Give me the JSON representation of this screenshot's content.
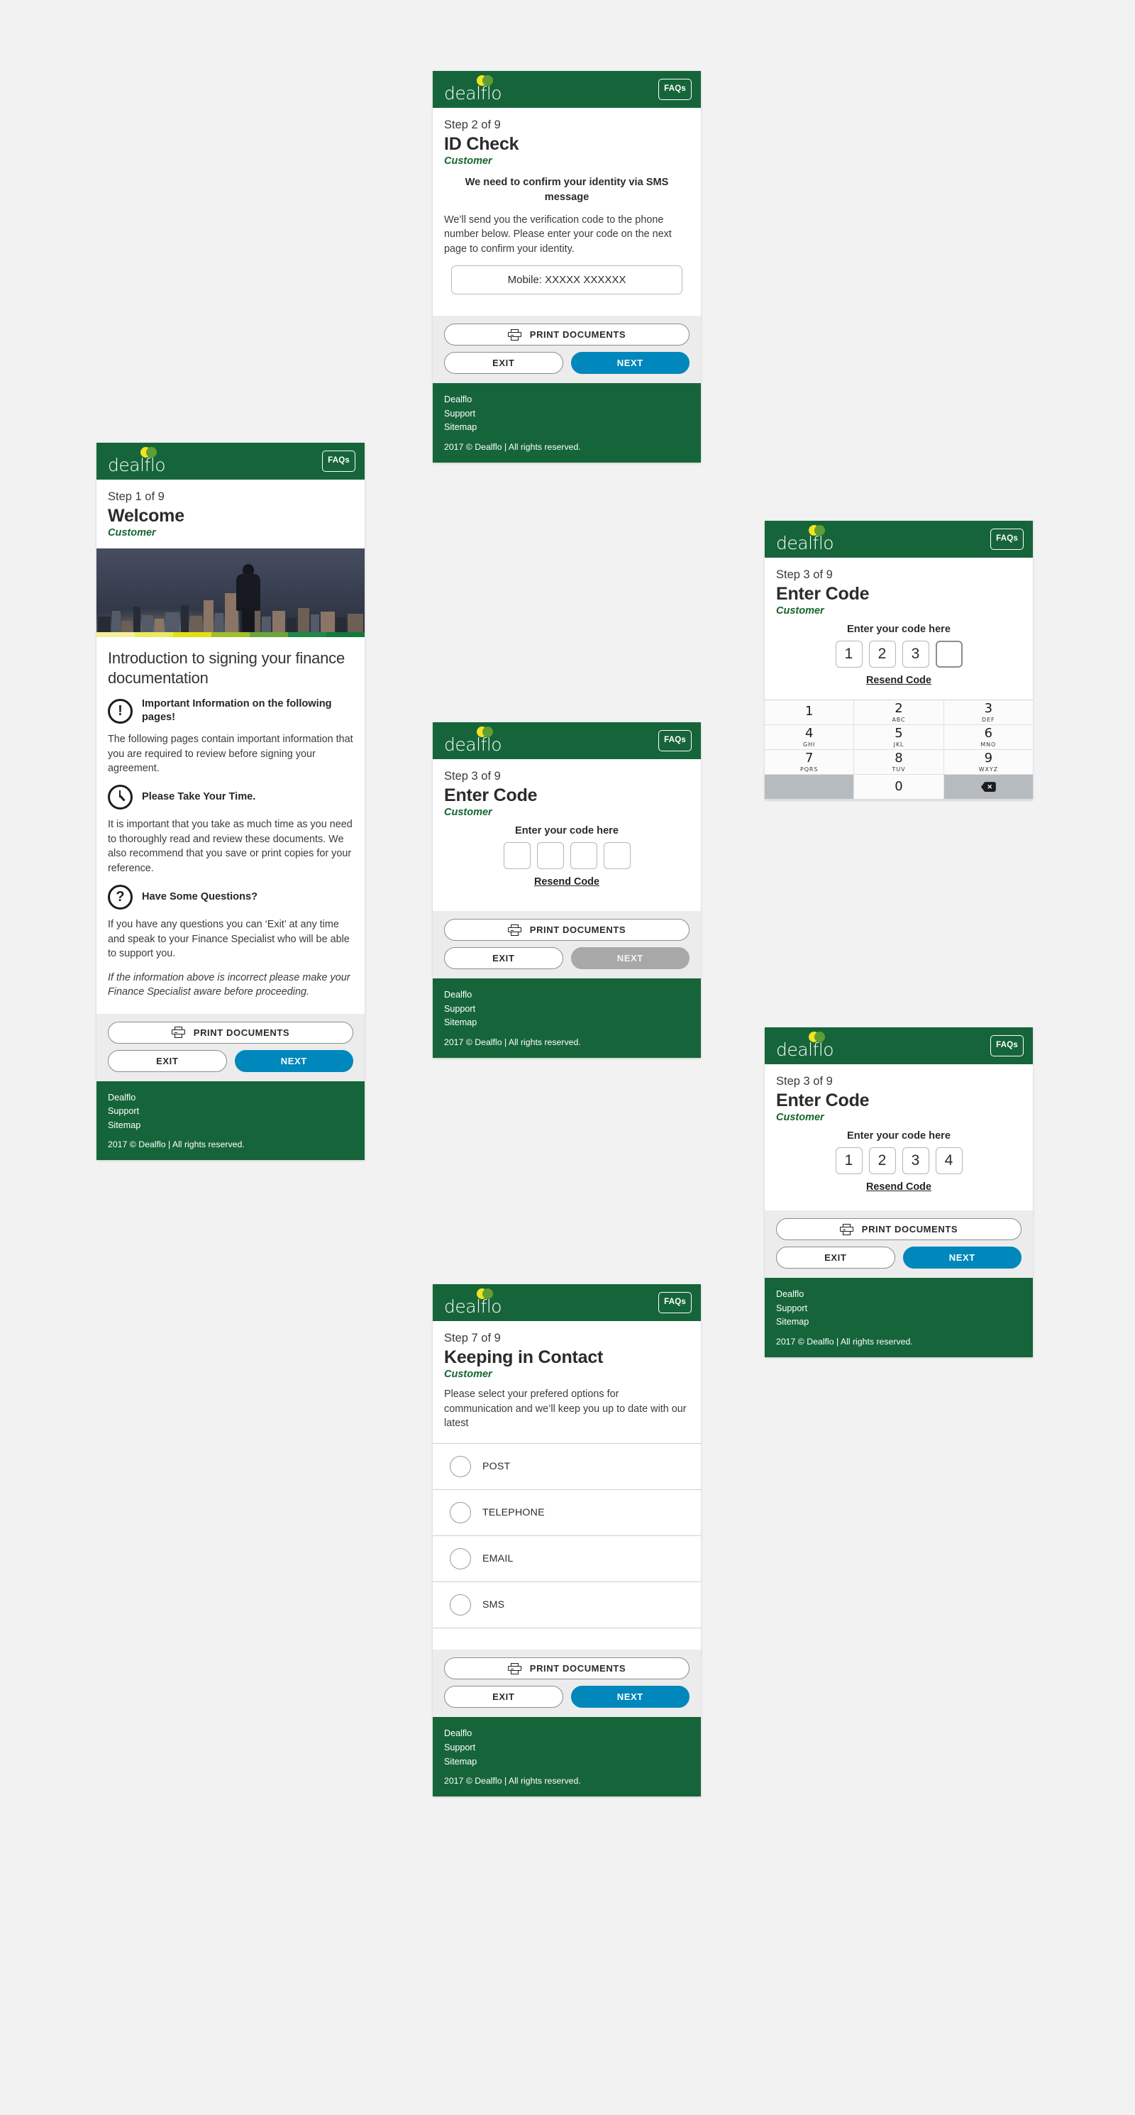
{
  "brand": {
    "logo_text": "dealflo",
    "faq_label": "FAQs",
    "green": "#16653a",
    "accent_blue": "#0087bb",
    "disabled_grey": "#a8a8a8"
  },
  "common": {
    "print_label": "PRINT DOCUMENTS",
    "exit_label": "EXIT",
    "next_label": "NEXT",
    "role": "Customer"
  },
  "footer": {
    "links": [
      "Dealflo",
      "Support",
      "Sitemap"
    ],
    "copyright": "2017 © Dealflo | All rights reserved."
  },
  "screens": {
    "welcome": {
      "step": "Step 1 of 9",
      "title": "Welcome",
      "role": "Customer",
      "heading": "Introduction to signing your finance documentation",
      "blocks": [
        {
          "icon": "exclamation-icon",
          "icon_glyph": "!",
          "label": "Important Information on the following pages!",
          "text": "The following pages contain important information that you are required to review before signing your agreement."
        },
        {
          "icon": "clock-icon",
          "icon_glyph": "",
          "label": "Please Take Your Time.",
          "text": "It is important that you take as much time as you need to thoroughly read and review these documents. We also recommend that you save or print copies for your reference."
        },
        {
          "icon": "question-icon",
          "icon_glyph": "?",
          "label": "Have Some Questions?",
          "text": "If you have any questions you can ‘Exit’ at any time and speak to your Finance Specialist who will be able to support you."
        }
      ],
      "note": "If the information above is incorrect please make your Finance Specialist aware before proceeding."
    },
    "id_check": {
      "step": "Step 2 of 9",
      "title": "ID Check",
      "role": "Customer",
      "lead": "We need to confirm your identity via SMS message",
      "body": "We’ll send you the verification code to the phone number below. Please enter your code on the next page to confirm your identity.",
      "mobile_value": "Mobile: XXXXX XXXXXX",
      "next_enabled": true
    },
    "enter_code_empty": {
      "step": "Step 3 of 9",
      "title": "Enter Code",
      "role": "Customer",
      "code_label": "Enter your code here",
      "digits": [
        "",
        "",
        "",
        ""
      ],
      "focus_index": -1,
      "resend_label": "Resend Code",
      "next_enabled": false
    },
    "enter_code_keypad": {
      "step": "Step 3 of 9",
      "title": "Enter Code",
      "role": "Customer",
      "code_label": "Enter your code here",
      "digits": [
        "1",
        "2",
        "3",
        ""
      ],
      "focus_index": 3,
      "resend_label": "Resend Code",
      "keypad": [
        [
          {
            "num": "1",
            "abc": ""
          },
          {
            "num": "2",
            "abc": "ABC"
          },
          {
            "num": "3",
            "abc": "DEF"
          }
        ],
        [
          {
            "num": "4",
            "abc": "GHI"
          },
          {
            "num": "5",
            "abc": "JKL"
          },
          {
            "num": "6",
            "abc": "MNO"
          }
        ],
        [
          {
            "num": "7",
            "abc": "PQRS"
          },
          {
            "num": "8",
            "abc": "TUV"
          },
          {
            "num": "9",
            "abc": "WXYZ"
          }
        ],
        [
          {
            "num": "",
            "abc": "",
            "kind": "blank"
          },
          {
            "num": "0",
            "abc": ""
          },
          {
            "num": "",
            "abc": "",
            "kind": "delete"
          }
        ]
      ]
    },
    "enter_code_filled": {
      "step": "Step 3 of 9",
      "title": "Enter Code",
      "role": "Customer",
      "code_label": "Enter your code here",
      "digits": [
        "1",
        "2",
        "3",
        "4"
      ],
      "focus_index": -1,
      "resend_label": "Resend Code",
      "next_enabled": true
    },
    "keeping_in_contact": {
      "step": "Step 7 of 9",
      "title": "Keeping in Contact",
      "role": "Customer",
      "body": "Please select your prefered options for communication and we’ll keep you up to date with our latest",
      "options": [
        "POST",
        "TELEPHONE",
        "EMAIL",
        "SMS"
      ],
      "next_enabled": true
    }
  }
}
